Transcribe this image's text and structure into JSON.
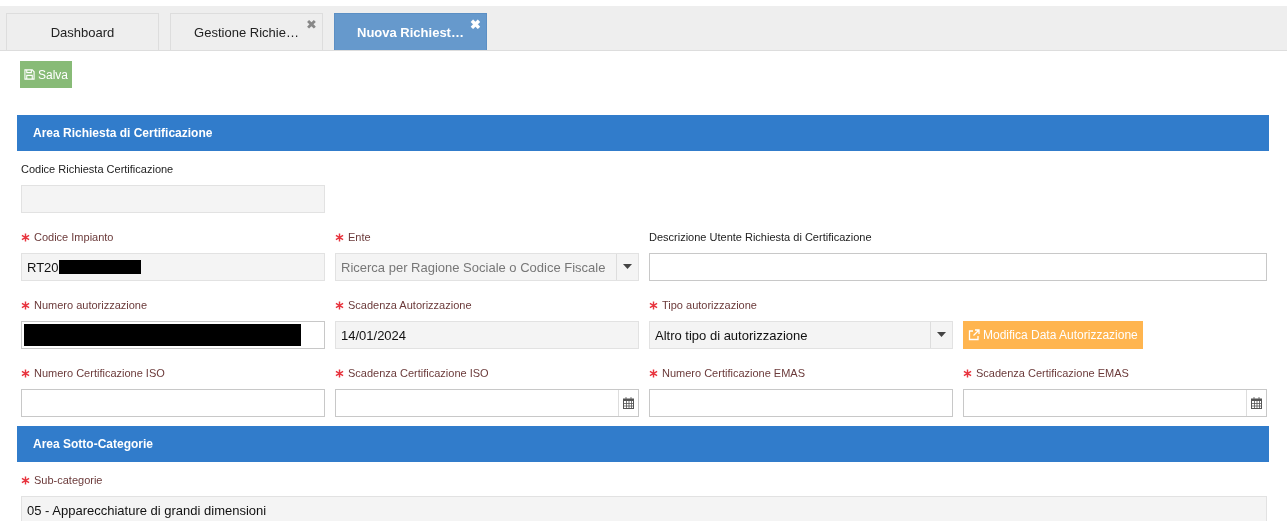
{
  "tabs": [
    {
      "label": "Dashboard",
      "selected": false
    },
    {
      "label": "Gestione Richie…",
      "selected": false,
      "close_glyph": "✖"
    },
    {
      "label": "Nuova Richiest…",
      "selected": true,
      "close_glyph": "✖"
    }
  ],
  "save_button": {
    "label": "Salva"
  },
  "sections": [
    {
      "title": "Area Richiesta di Certificazione",
      "rows": [
        [
          {
            "kind": "text",
            "label": "Codice Richiesta Certificazione",
            "required": false,
            "readonly": true
          }
        ],
        [
          {
            "kind": "text",
            "label": "Codice Impianto",
            "required": true,
            "readonly": true,
            "value": "RT20",
            "redacted": true
          },
          {
            "kind": "select",
            "label": "Ente",
            "required": true,
            "readonly": true,
            "placeholder": "Ricerca per Ragione Sociale o Codice Fiscale"
          },
          {
            "kind": "text-wide",
            "label": "Descrizione Utente Richiesta di Certificazione",
            "required": false,
            "readonly": false
          }
        ],
        [
          {
            "kind": "text",
            "label": "Numero autorizzazione",
            "required": true,
            "readonly": false,
            "redacted": true
          },
          {
            "kind": "text",
            "label": "Scadenza Autorizzazione",
            "required": true,
            "readonly": true,
            "value": "14/01/2024"
          },
          {
            "kind": "select",
            "label": "Tipo autorizzazione",
            "required": true,
            "readonly": true,
            "value": "Altro tipo di autorizzazione"
          },
          {
            "kind": "button",
            "label": "Modifica Data Autorizzazione"
          }
        ],
        [
          {
            "kind": "text",
            "label": "Numero Certificazione ISO",
            "required": true,
            "readonly": false
          },
          {
            "kind": "date",
            "label": "Scadenza Certificazione ISO",
            "required": true,
            "readonly": false
          },
          {
            "kind": "text",
            "label": "Numero Certificazione EMAS",
            "required": true,
            "readonly": false
          },
          {
            "kind": "date",
            "label": "Scadenza Certificazione EMAS",
            "required": true,
            "readonly": false
          }
        ]
      ]
    },
    {
      "title": "Area Sotto-Categorie",
      "rows": [
        [
          {
            "kind": "text-full",
            "label": "Sub-categorie",
            "required": true,
            "readonly": true,
            "value": "05 - Apparecchiature di grandi dimensioni"
          }
        ]
      ]
    }
  ]
}
